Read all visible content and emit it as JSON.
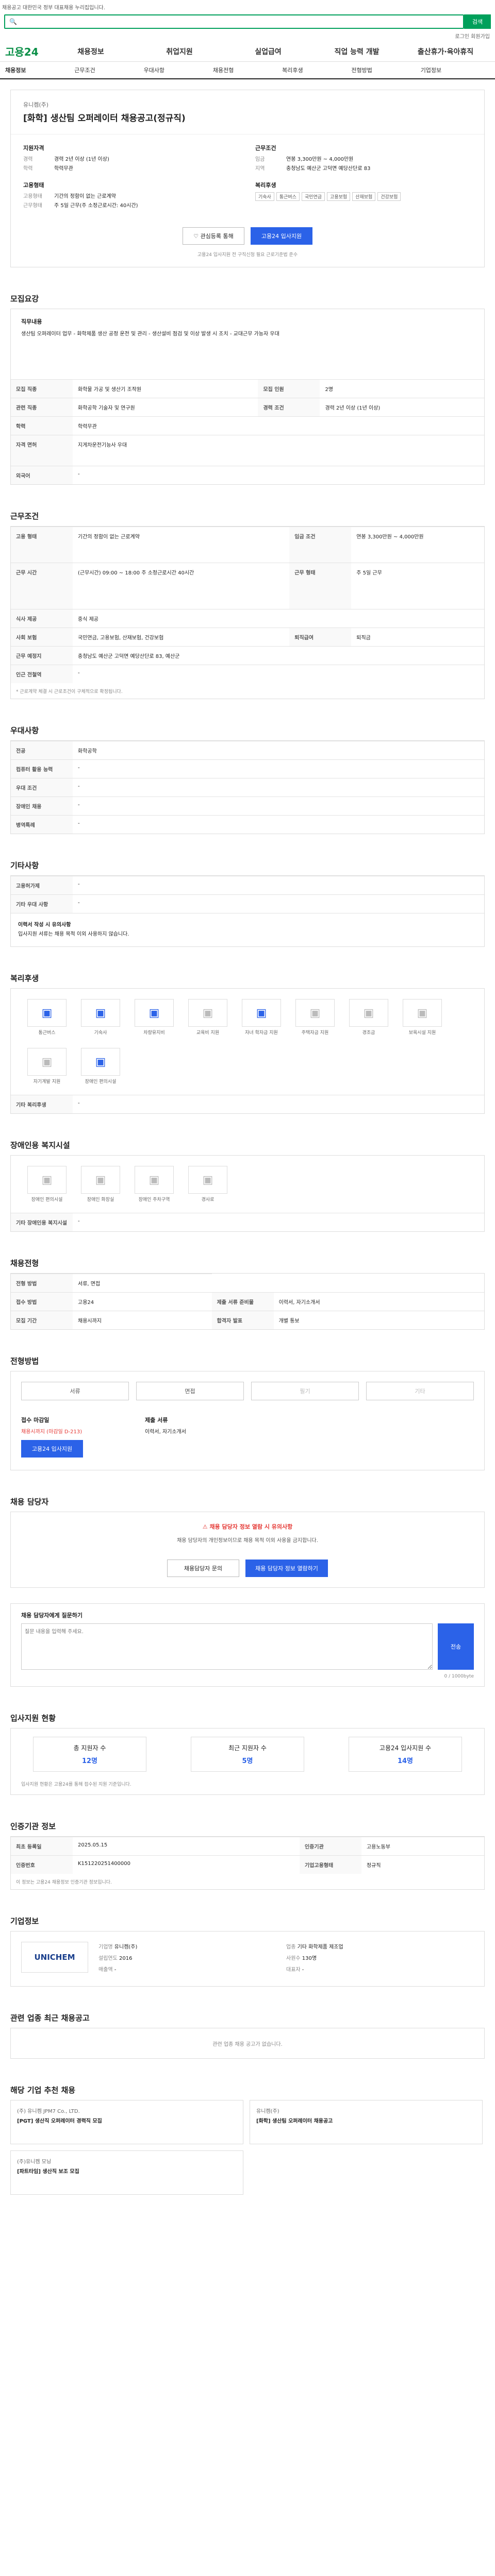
{
  "topbar": {
    "text": "채용공고 대한민국 정부 대표채용 누리집입니다."
  },
  "search": {
    "placeholder": "",
    "button": "검색"
  },
  "util": {
    "links": "로그인  회원가입"
  },
  "gnb": {
    "logo": "고용24",
    "menus": [
      "채용정보",
      "취업지원",
      "실업급여",
      "직업 능력 개발",
      "출산휴가·육아휴직"
    ]
  },
  "tabs": [
    "채용정보",
    "근무조건",
    "우대사항",
    "채용전형",
    "복리후생",
    "전형방법",
    "기업정보"
  ],
  "job": {
    "corp": "유니켐(주)",
    "title": "[화학] 생산팀 오퍼레이터 채용공고(정규직)",
    "left_head": "지원자격",
    "right_head": "근무조건",
    "left": [
      [
        "경력",
        "경력 2년 이상 (1년 이상)"
      ],
      [
        "학력",
        "학력무관"
      ]
    ],
    "right": [
      [
        "임금",
        "연봉 3,300만원 ~ 4,000만원"
      ],
      [
        "지역",
        "충청남도 예산군 고덕면 예당산단로 83"
      ]
    ],
    "left2_head": "고용형태",
    "left2": [
      [
        "고용형태",
        "기간의 정함이 없는 근로계약"
      ],
      [
        "근무형태",
        "주 5일 근무(주 소정근로시간: 40시간)"
      ]
    ],
    "right2_head": "복리후생",
    "tags": [
      "기숙사",
      "통근버스",
      "국민연금",
      "고용보험",
      "산재보험",
      "건강보험"
    ],
    "btn_save": "관심등록 통해",
    "btn_apply": "고용24 입사지원",
    "note": "고용24 입사지원 전 구직신청 필요  근로기준법 준수"
  },
  "s_recruit": {
    "title": "모집요강",
    "sub_head": "직무내용",
    "desc": "생산팀 오퍼레이터 업무  - 화학제품 생산 공정 운전 및 관리  - 생산설비 점검 및 이상 발생 시 조치  - 교대근무 가능자 우대",
    "rows": [
      [
        "모집 직종",
        "화학물 가공 및 생산기 조작원"
      ],
      [
        "모집 인원",
        "2명"
      ],
      [
        "관련 직종",
        "화학공학 기술자 및 연구원"
      ],
      [
        "경력 조건",
        "경력 2년 이상 (1년 이상)"
      ],
      [
        "학력",
        "학력무관"
      ],
      [
        "자격 면허",
        "지게차운전기능사 우대"
      ],
      [
        "외국어",
        "-"
      ]
    ]
  },
  "s_cond": {
    "title": "근무조건",
    "rows": [
      [
        "고용 형태",
        "기간의 정함이 없는 근로계약"
      ],
      [
        "임금 조건",
        "연봉 3,300만원 ~ 4,000만원"
      ],
      [
        "근무 시간",
        "(근무시간) 09:00 ~ 18:00  주 소정근로시간 40시간"
      ],
      [
        "근무 형태",
        "주 5일 근무"
      ],
      [
        "식사 제공",
        "중식 제공"
      ],
      [
        "사회 보험",
        "국민연금, 고용보험, 산재보험, 건강보험"
      ],
      [
        "퇴직급여",
        "퇴직금"
      ],
      [
        "근무 예정지",
        "충청남도 예산군 고덕면 예당산단로 83, 예산군"
      ],
      [
        "인근 전철역",
        "-"
      ]
    ],
    "note": "* 근로계약 체결 시 근로조건이 구체적으로 확정됩니다."
  },
  "s_pref": {
    "title": "우대사항",
    "rows": [
      [
        "전공",
        "화학공학"
      ],
      [
        "컴퓨터 활용 능력",
        "-"
      ],
      [
        "우대 조건",
        "-"
      ],
      [
        "장애인 채용",
        "-"
      ],
      [
        "병역특례",
        "-"
      ]
    ]
  },
  "s_etc": {
    "title": "기타사항",
    "rows": [
      [
        "고용허가제",
        "-"
      ],
      [
        "기타 우대 사항",
        "-"
      ]
    ],
    "note1": "이력서 작성 시 유의사항",
    "note2": "입사지원 서류는 채용 목적 이외 사용하지 않습니다."
  },
  "s_welfare": {
    "title": "복리후생",
    "items": [
      "통근버스",
      "기숙사",
      "차량유지비",
      "교육비 지원",
      "자녀 학자금 지원",
      "주택자금 지원",
      "경조금",
      "보육시설 지원",
      "자기계발 지원",
      "장애인 편의시설"
    ],
    "on": [
      0,
      1,
      2,
      4,
      9
    ],
    "sub": "기타 복리후생",
    "sub_val": "-"
  },
  "s_disabled": {
    "title": "장애인용 복지시설",
    "items": [
      "장애인 편의시설",
      "장애인 화장실",
      "장애인 주차구역",
      "경사로"
    ],
    "sub": "기타 장애인용 복지시설",
    "sub_val": "-"
  },
  "s_select": {
    "title": "채용전형",
    "rows": [
      [
        "전형 방법",
        "서류, 면접"
      ],
      [
        "접수 방법",
        "고용24"
      ],
      [
        "제출 서류 준비물",
        "이력서, 자기소개서"
      ],
      [
        "모집 기간",
        "채용시까지"
      ],
      [
        "합격자 발표",
        "개별 통보"
      ]
    ]
  },
  "s_method": {
    "title": "전형방법",
    "items": [
      "서류",
      "면접",
      "필기",
      "기타"
    ],
    "apply_head": "접수 마감일",
    "apply_val": "채용시까지 (마감일 D-213)",
    "apply_btn": "고용24 입사지원",
    "docs_head": "제출 서류",
    "docs_val": "이력서, 자기소개서"
  },
  "s_contact": {
    "title": "채용 담당자",
    "alert": "채용 담당자 정보 열람 시 유의사항",
    "msg": "채용 담당자의 개인정보이므로 채용 목적 이외 사용을 금지합니다.",
    "b1": "채용담당자 문의",
    "b2": "채용 담당자 정보 열람하기"
  },
  "s_qna": {
    "title": "채용 담당자에게 질문하기",
    "placeholder": "질문 내용을 입력해 주세요.",
    "btn": "전송",
    "count": "0 / 1000byte"
  },
  "s_stat": {
    "title": "입사지원 현황",
    "items": [
      [
        "총 지원자 수",
        "12명"
      ],
      [
        "최근 지원자 수",
        "5명"
      ],
      [
        "고용24 입사지원 수",
        "14명"
      ]
    ],
    "note": "입사지원 현황은 고용24를 통해 접수된 지원 기준입니다."
  },
  "s_reg": {
    "title": "인증기관 정보",
    "rows": [
      [
        "최초 등록일",
        "2025.05.15"
      ],
      [
        "인증기관",
        "고용노동부"
      ],
      [
        "인증번호",
        "K151220251400000"
      ],
      [
        "기업고용형태",
        "정규직"
      ]
    ],
    "note": "이 정보는 고용24 채용정보 인증기관 정보입니다."
  },
  "s_corp": {
    "title": "기업정보",
    "logo": "UNICHEM",
    "rows": [
      [
        "기업명",
        "유니켐(주)"
      ],
      [
        "업종",
        "기타 화학제품 제조업"
      ],
      [
        "설립연도",
        "2016"
      ],
      [
        "사원수",
        "130명"
      ],
      [
        "매출액",
        "-"
      ],
      [
        "대표자",
        "-"
      ]
    ]
  },
  "s_recent": {
    "title": "관련 업종 최근 채용공고",
    "empty": "관련 업종 채용 공고가 없습니다."
  },
  "s_more": {
    "title": "해당 기업 추천 채용",
    "cards": [
      [
        "(주) 유니켐 JPM7 Co., LTD.",
        "[PGT] 생산직 오퍼레이터 경력직 모집"
      ],
      [
        "유니켐(주)",
        "[화학] 생산팀 오퍼레이터 채용공고"
      ],
      [
        "(주)유니켐 모닝",
        "[파트타임] 생산직 보조 모집"
      ]
    ]
  }
}
